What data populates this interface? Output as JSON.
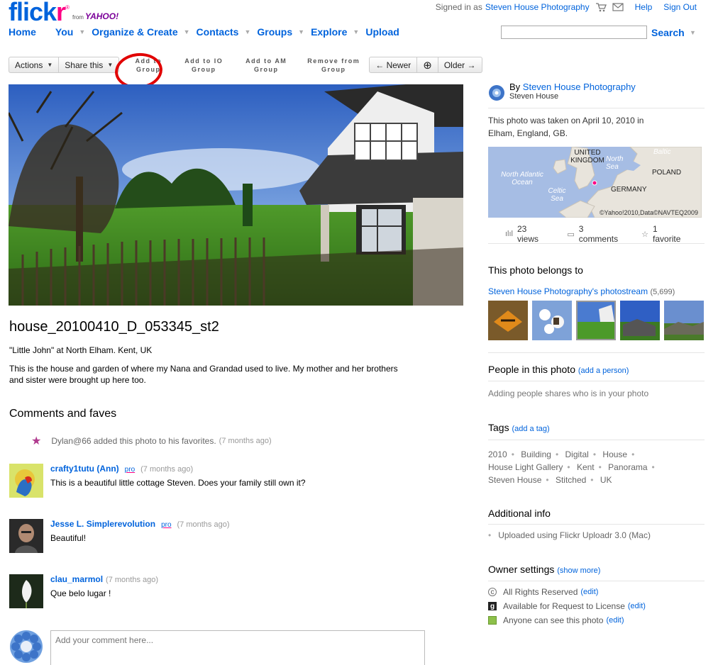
{
  "header": {
    "logo_text_a": "flick",
    "logo_text_b": "r",
    "logo_reg": "®",
    "logo_from": "from",
    "logo_yahoo": "YAHOO!",
    "signed_in_prefix": "Signed in as",
    "signed_in_user": "Steven House Photography",
    "help": "Help",
    "sign_out": "Sign Out"
  },
  "nav": {
    "home": "Home",
    "you": "You",
    "organize": "Organize & Create",
    "contacts": "Contacts",
    "groups": "Groups",
    "explore": "Explore",
    "upload": "Upload",
    "search_value": "",
    "search_button": "Search"
  },
  "toolbar": {
    "actions": "Actions",
    "share": "Share this",
    "add_to_group_1": "Add to",
    "add_to_group_2": "Group",
    "add_io_1": "Add to IO",
    "add_io_2": "Group",
    "add_am_1": "Add to AM",
    "add_am_2": "Group",
    "remove_1": "Remove from",
    "remove_2": "Group",
    "newer": "← Newer",
    "zoom": "⊕",
    "older": "Older →"
  },
  "photo": {
    "title": "house_20100410_D_053345_st2",
    "subtitle": "\"Little John\" at North Elham. Kent, UK",
    "description": "This is the house and garden of where my Nana and Grandad used to live. My mother and her brothers and sister were brought up here too."
  },
  "comments": {
    "heading": "Comments and faves",
    "fav_text": "Dylan@66 added this photo to his favorites.",
    "fav_ago": "(7 months ago)",
    "items": [
      {
        "author": "crafty1tutu (Ann)",
        "pro": "pro",
        "ago": "(7 months ago)",
        "text": "This is a beautiful little cottage Steven. Does your family still own it?"
      },
      {
        "author": "Jesse L. Simplerevolution",
        "pro": "pro",
        "ago": "(7 months ago)",
        "text": "Beautiful!"
      },
      {
        "author": "clau_marmol",
        "pro": "",
        "ago": "(7 months ago)",
        "text": "Que belo lugar !"
      }
    ],
    "placeholder": "Add your comment here..."
  },
  "sidebar": {
    "by": "By",
    "owner": "Steven House Photography",
    "owner_real": "Steven House",
    "taken": "This photo was taken on April 10, 2010 in Elham, England, GB.",
    "map_labels": {
      "uk": "UNITED KINGDOM",
      "north_sea": "North Sea",
      "baltic": "Baltic",
      "poland": "POLAND",
      "atlantic": "North Atlantic Ocean",
      "celtic": "Celtic Sea",
      "germany": "GERMANY",
      "copyright": "©Yahoo!2010,Data©NAVTEQ2009"
    },
    "views": "23 views",
    "comments": "3 comments",
    "favorites": "1 favorite",
    "belongs_heading": "This photo belongs to",
    "photostream": "Steven House Photography's photostream",
    "photostream_count": "(5,699)",
    "people_heading": "People in this photo",
    "add_person": "(add a person)",
    "people_text": "Adding people shares who is in your photo",
    "tags_heading": "Tags",
    "add_tag": "(add a tag)",
    "tags": [
      "2010",
      "Building",
      "Digital",
      "House",
      "House Light Gallery",
      "Kent",
      "Panorama",
      "Steven House",
      "Stitched",
      "UK"
    ],
    "additional_heading": "Additional info",
    "additional_item": "Uploaded using Flickr Uploadr 3.0 (Mac)",
    "owner_settings_heading": "Owner settings",
    "show_more": "(show more)",
    "settings": [
      {
        "text": "All Rights Reserved",
        "edit": "(edit)"
      },
      {
        "text": "Available for Request to License",
        "edit": "(edit)"
      },
      {
        "text": "Anyone can see this photo",
        "edit": "(edit)"
      }
    ]
  }
}
